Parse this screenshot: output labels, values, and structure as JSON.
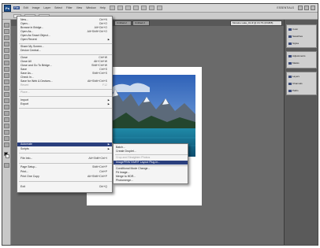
{
  "menubar": {
    "logo": "Ps",
    "items": [
      "File",
      "Edit",
      "Image",
      "Layer",
      "Select",
      "Filter",
      "View",
      "Window",
      "Help"
    ],
    "workspace": "ESSENTIALS"
  },
  "doc_tabs": [
    {
      "label": "Untitled-1"
    },
    {
      "label": "Untitled-2"
    },
    {
      "label": "Untitled-3"
    },
    {
      "label": "Moraine Lake_01.tif @ 16.7% (RGB/8)"
    }
  ],
  "file_menu": {
    "items": [
      {
        "label": "New...",
        "shortcut": "Ctrl+N"
      },
      {
        "label": "Open...",
        "shortcut": "Ctrl+O"
      },
      {
        "label": "Browse in Bridge...",
        "shortcut": "Alt+Ctrl+O"
      },
      {
        "label": "Open As...",
        "shortcut": "Alt+Shift+Ctrl+O"
      },
      {
        "label": "Open As Smart Object...",
        "shortcut": ""
      },
      {
        "label": "Open Recent",
        "shortcut": "",
        "submenu": true
      },
      {
        "label": "Share My Screen...",
        "shortcut": ""
      },
      {
        "label": "Device Central...",
        "shortcut": ""
      },
      {
        "label": "Close",
        "shortcut": "Ctrl+W"
      },
      {
        "label": "Close All",
        "shortcut": "Alt+Ctrl+W"
      },
      {
        "label": "Close and Go To Bridge...",
        "shortcut": "Shift+Ctrl+W"
      },
      {
        "label": "Save",
        "shortcut": "Ctrl+S"
      },
      {
        "label": "Save As...",
        "shortcut": "Shift+Ctrl+S"
      },
      {
        "label": "Check In...",
        "shortcut": ""
      },
      {
        "label": "Save for Web & Devices...",
        "shortcut": "Alt+Shift+Ctrl+S"
      },
      {
        "label": "Revert",
        "shortcut": "F12"
      },
      {
        "label": "Place...",
        "shortcut": ""
      },
      {
        "label": "Import",
        "shortcut": "",
        "submenu": true
      },
      {
        "label": "Export",
        "shortcut": "",
        "submenu": true
      },
      {
        "label": "Automate",
        "shortcut": "",
        "submenu": true
      },
      {
        "label": "Scripts",
        "shortcut": "",
        "submenu": true
      },
      {
        "label": "File Info...",
        "shortcut": "Alt+Shift+Ctrl+I"
      },
      {
        "label": "Page Setup...",
        "shortcut": "Shift+Ctrl+P"
      },
      {
        "label": "Print...",
        "shortcut": "Ctrl+P"
      },
      {
        "label": "Print One Copy",
        "shortcut": "Alt+Shift+Ctrl+P"
      },
      {
        "label": "Exit",
        "shortcut": "Ctrl+Q"
      }
    ]
  },
  "automate_menu": {
    "items": [
      {
        "label": "Batch..."
      },
      {
        "label": "Create Droplet..."
      },
      {
        "label": "Crop and Straighten Photos"
      },
      {
        "label": "ImagePRINT/IMRF Layout Plug-In..."
      },
      {
        "label": "Conditional Mode Change..."
      },
      {
        "label": "Fit Image..."
      },
      {
        "label": "Merge to HDR..."
      },
      {
        "label": "Photomerge..."
      }
    ]
  },
  "panels": {
    "group1": [
      "Color",
      "Swatches",
      "Styles"
    ],
    "group2": [
      "Adjustments",
      "Masks"
    ],
    "group3": [
      "Layers",
      "Channels",
      "Paths"
    ]
  },
  "colors": {
    "highlight": "#2a3f7e",
    "workspace_bg": "#6a6a6a",
    "menu_bg": "#f4f4f4"
  }
}
